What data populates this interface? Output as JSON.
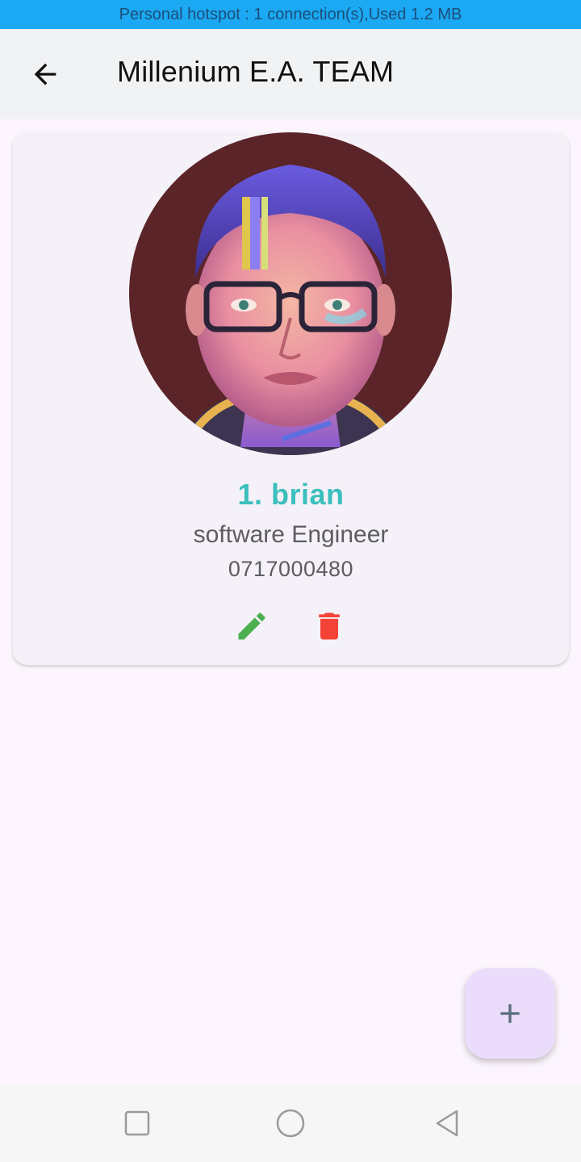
{
  "status_bar": {
    "text": "Personal hotspot : 1 connection(s),Used  1.2 MB"
  },
  "app_bar": {
    "title": "Millenium E.A. TEAM",
    "back_icon": "arrow-back-icon"
  },
  "members": [
    {
      "name": "1. brian",
      "role": "software Engineer",
      "phone": "0717000480",
      "actions": [
        {
          "icon": "edit-icon",
          "color": "#4caf50"
        },
        {
          "icon": "delete-icon",
          "color": "#f44336"
        }
      ]
    }
  ],
  "fab": {
    "icon": "plus-icon"
  },
  "nav_bar": {
    "icons": [
      "recent-apps-icon",
      "home-icon",
      "back-icon"
    ]
  },
  "colors": {
    "status_bar": "#1aa9f2",
    "app_bar": "#f1f2f4",
    "name_accent": "#3bbfbd",
    "fab_bg": "#eadcfa",
    "background": "#fcf5fd"
  }
}
